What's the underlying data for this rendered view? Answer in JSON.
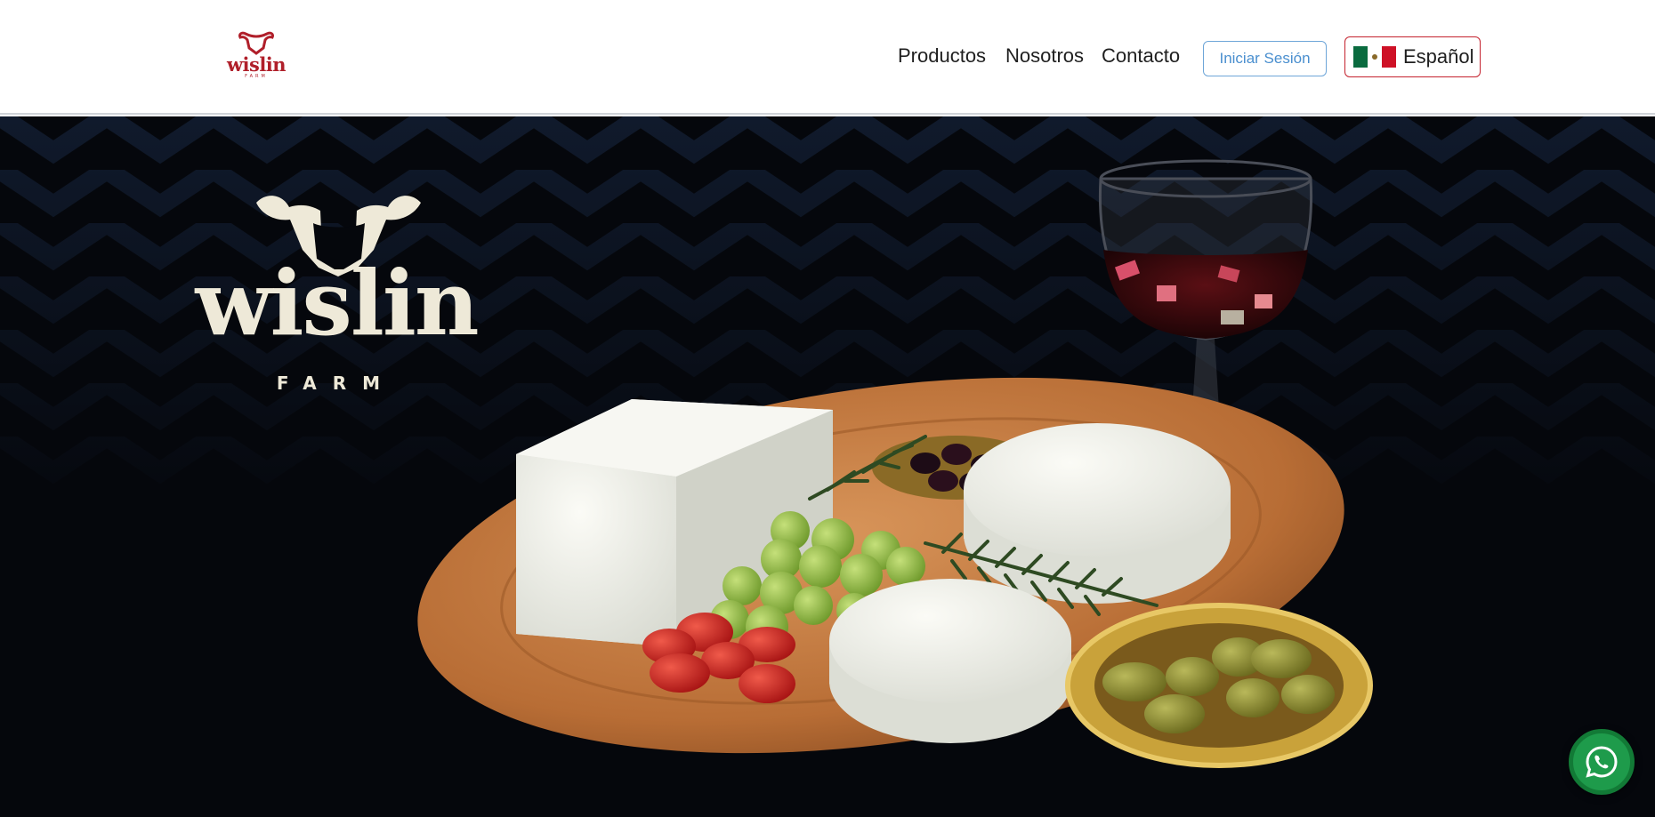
{
  "header": {
    "logo": {
      "name": "wislin",
      "subtitle": "FARM",
      "icon": "bull-head-icon"
    },
    "nav": [
      {
        "label": "Productos"
      },
      {
        "label": "Nosotros"
      },
      {
        "label": "Contacto"
      }
    ],
    "login_label": "Iniciar Sesión",
    "language": {
      "label": "Español",
      "icon": "mexico-flag-icon"
    }
  },
  "hero": {
    "logo": {
      "name": "wislin",
      "subtitle": "FARM",
      "icon": "bull-head-icon"
    },
    "image": "cheese-board-with-grapes-olives-tomatoes-rosemary-and-wine-glass"
  },
  "whatsapp": {
    "icon": "whatsapp-icon"
  },
  "colors": {
    "brand_red": "#b01f2a",
    "login_blue": "#4a8fcf",
    "lang_border": "#c4222e",
    "hero_bg": "#05070c",
    "logo_cream": "#eee9d8",
    "whatsapp_green": "#1e9b4b"
  }
}
